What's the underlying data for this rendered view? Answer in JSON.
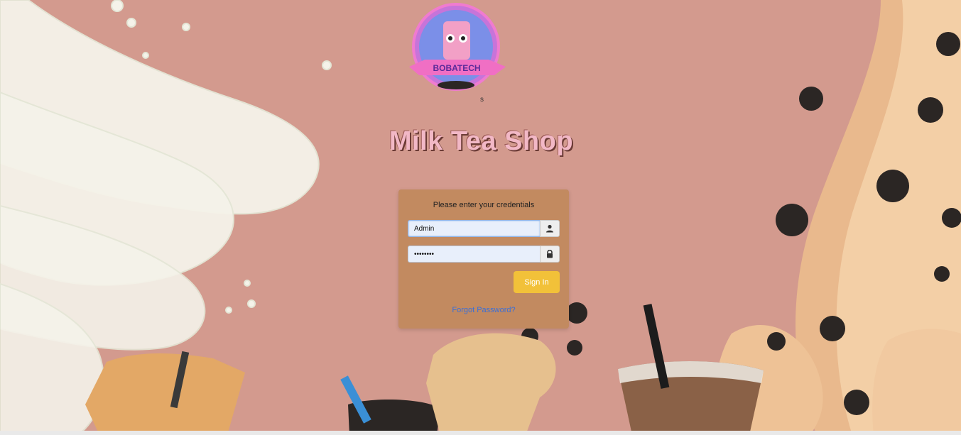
{
  "brand": {
    "logo_text": "BOBATECH",
    "logo_caption": "s",
    "title": "Milk Tea Shop"
  },
  "login": {
    "prompt": "Please enter your credentials",
    "username_value": "Admin",
    "password_value": "••••••••",
    "username_icon": "user-icon",
    "password_icon": "lock-icon",
    "signin_label": "Sign In",
    "forgot_label": "Forgot Password?"
  },
  "colors": {
    "background": "#d39a8e",
    "card": "#c28a60",
    "signin_button": "#f2c139",
    "title": "#f2b8c6",
    "link": "#3a6fd8"
  }
}
